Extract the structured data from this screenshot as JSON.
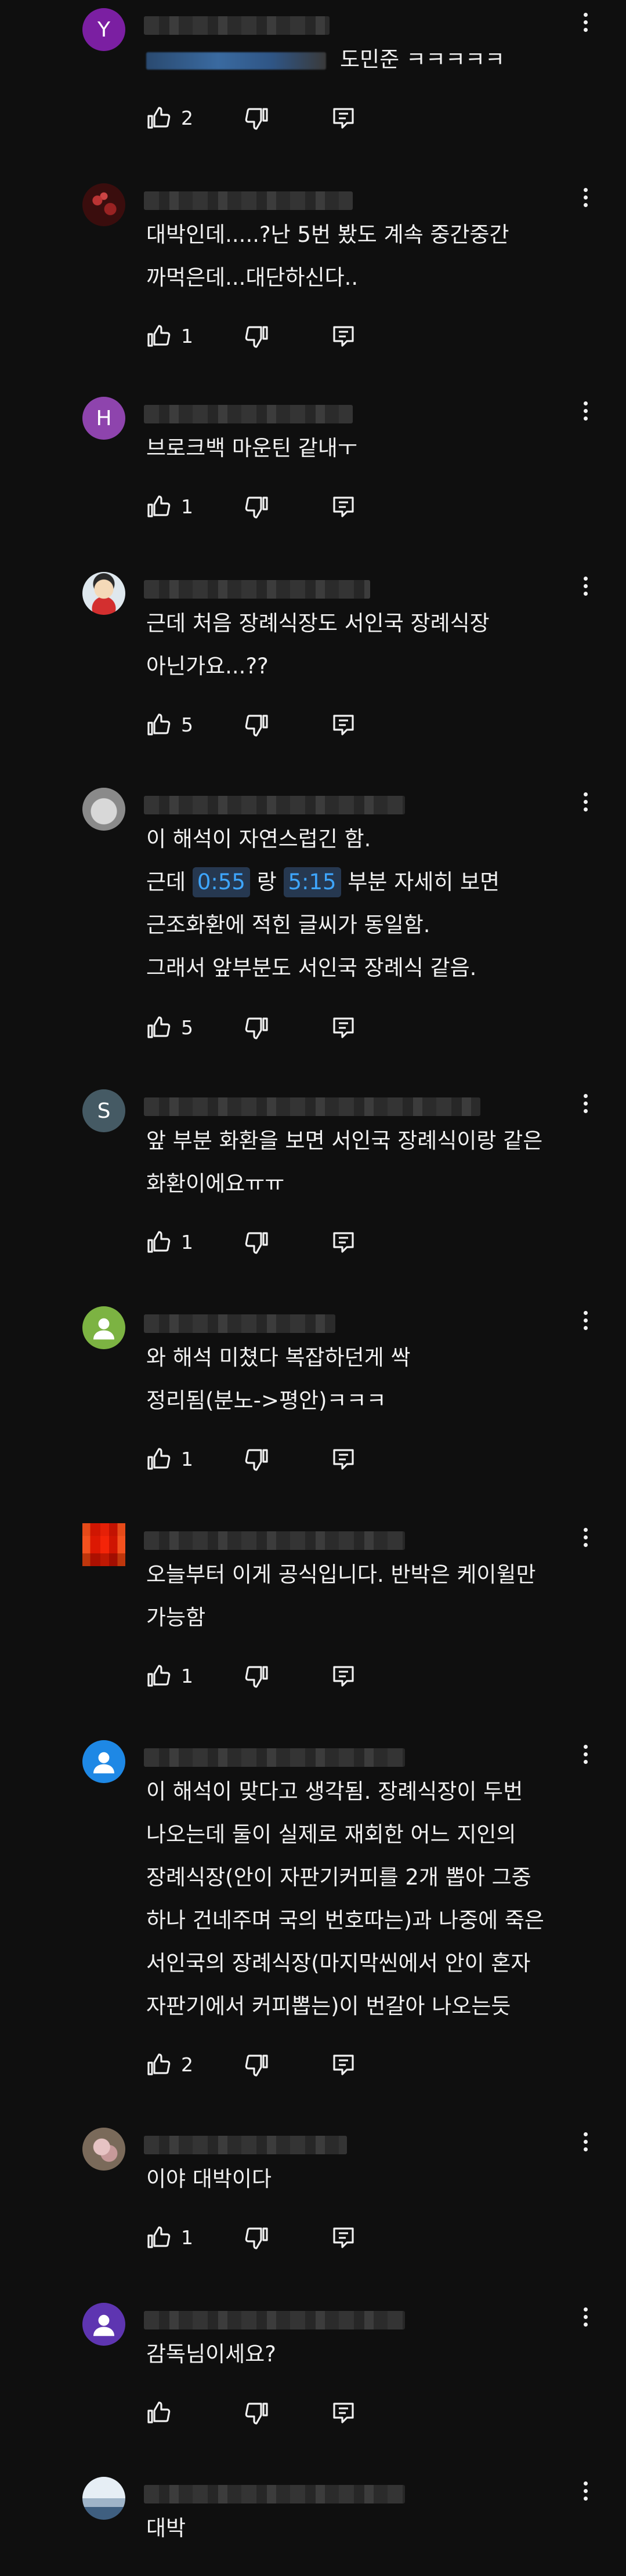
{
  "comments": [
    {
      "avatar_letter": "Y",
      "avatar_color": "#7b1fa2",
      "avatar_kind": "letter",
      "mention": true,
      "text": "도민준 ㅋㅋㅋㅋㅋ",
      "likes": "2"
    },
    {
      "avatar_letter": "",
      "avatar_color": "#5a1a1a",
      "avatar_kind": "image-dark-red",
      "mention": false,
      "text": "대박인데.....?난 5번 봤도 계속 중간중간\n까먹은데...대단하신다..",
      "likes": "1"
    },
    {
      "avatar_letter": "H",
      "avatar_color": "#8e44ad",
      "avatar_kind": "letter",
      "mention": false,
      "text": "브로크백 마운틴 같내ㅜ",
      "likes": "1"
    },
    {
      "avatar_letter": "",
      "avatar_color": "#dfe8ee",
      "avatar_kind": "image-cartoon",
      "mention": false,
      "text": "근데 처음 장례식장도 서인국 장례식장\n아닌가요...??",
      "likes": "5"
    },
    {
      "avatar_letter": "",
      "avatar_color": "#9a9a9a",
      "avatar_kind": "image-cat",
      "mention": false,
      "text_parts": {
        "line1": "이 해석이 자연스럽긴 함.",
        "pre": "근데 ",
        "ts1": "0:55",
        "mid": " 랑 ",
        "ts2": "5:15",
        "post": " 부분 자세히 보면",
        "line3": "근조화환에 적힌 글씨가 동일함.",
        "line4": "그래서 앞부분도 서인국 장례식 같음."
      },
      "likes": "5"
    },
    {
      "avatar_letter": "S",
      "avatar_color": "#455a64",
      "avatar_kind": "letter",
      "mention": false,
      "text": "앞 부분 화환을 보면 서인국 장례식이랑 같은\n화환이에요ㅠㅠ",
      "likes": "1"
    },
    {
      "avatar_letter": "",
      "avatar_color": "#7cb342",
      "avatar_kind": "default-person",
      "mention": false,
      "text": "와 해석 미쳤다 복잡하던게 싹\n정리됨(분노->평안)ㅋㅋㅋ",
      "likes": "1"
    },
    {
      "avatar_letter": "",
      "avatar_color": "#e64a19",
      "avatar_kind": "image-mosaic",
      "mention": false,
      "text": "오늘부터 이게 공식입니다. 반박은 케이윌만\n가능함",
      "likes": "1"
    },
    {
      "avatar_letter": "",
      "avatar_color": "#1e88e5",
      "avatar_kind": "default-person",
      "mention": false,
      "text": "이 해석이 맞다고 생각됨. 장례식장이 두번\n나오는데 둘이 실제로 재회한 어느 지인의\n장례식장(안이 자판기커피를 2개 뽑아 그중\n하나 건네주며 국의 번호따는)과 나중에 죽은\n서인국의 장례식장(마지막씬에서 안이 혼자\n자판기에서 커피뽑는)이 번갈아 나오는듯",
      "likes": "2"
    },
    {
      "avatar_letter": "",
      "avatar_color": "#b08a8a",
      "avatar_kind": "image-flower",
      "mention": false,
      "text": "이야 대박이다",
      "likes": "1"
    },
    {
      "avatar_letter": "",
      "avatar_color": "#5e35b1",
      "avatar_kind": "default-person",
      "mention": false,
      "text": "감독님이세요?",
      "likes": ""
    },
    {
      "avatar_letter": "",
      "avatar_color": "#c5d3e0",
      "avatar_kind": "image-light",
      "mention": false,
      "text": "대박",
      "likes": ""
    }
  ]
}
